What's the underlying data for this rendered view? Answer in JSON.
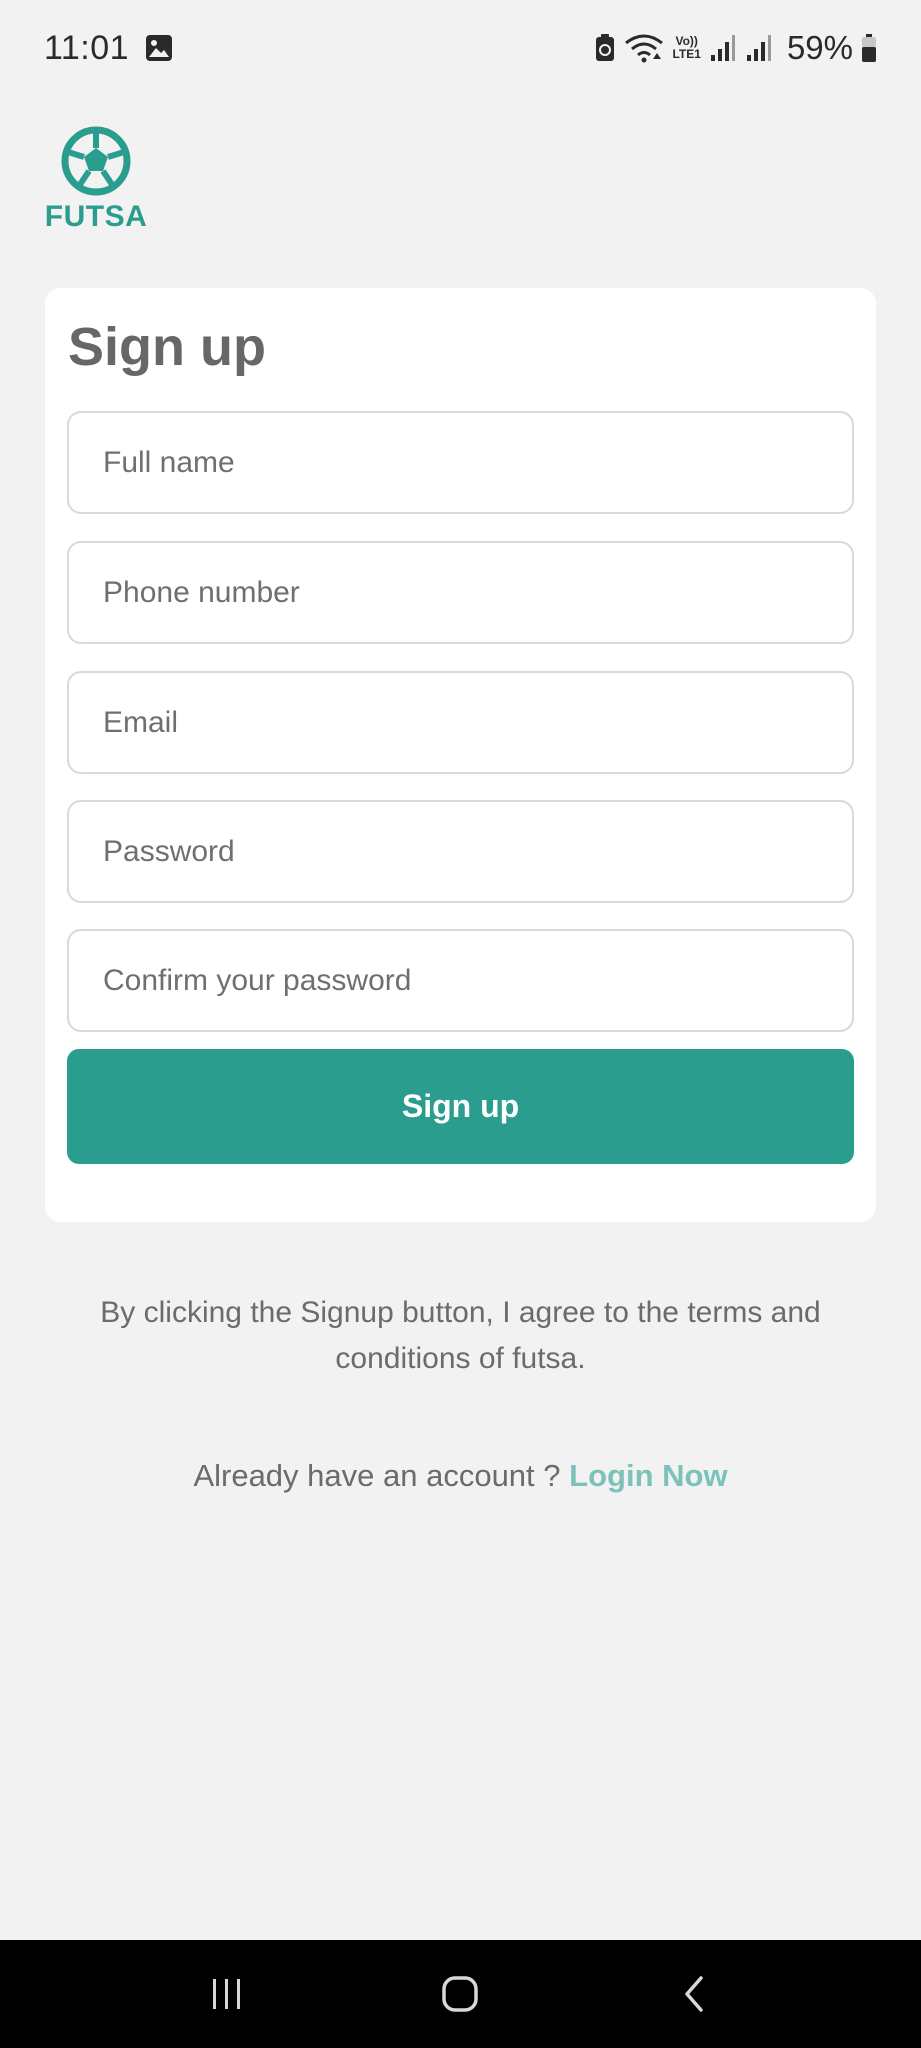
{
  "status_bar": {
    "time": "11:01",
    "battery_percent": "59%",
    "network_label_top": "Vo))",
    "network_label_bottom": "LTE1"
  },
  "brand": {
    "name": "FUTSA",
    "color": "#2a9d8f"
  },
  "form": {
    "title": "Sign up",
    "full_name_placeholder": "Full name",
    "phone_placeholder": "Phone number",
    "email_placeholder": "Email",
    "password_placeholder": "Password",
    "confirm_password_placeholder": "Confirm your password",
    "submit_label": "Sign up"
  },
  "terms_text": "By clicking the Signup button, I agree to the terms and conditions of futsa.",
  "login_prompt": {
    "text": "Already have an account ?",
    "link_label": "Login Now"
  },
  "nav_bar": {
    "recents_icon": "recents-icon",
    "home_icon": "home-icon",
    "back_icon": "back-icon"
  }
}
